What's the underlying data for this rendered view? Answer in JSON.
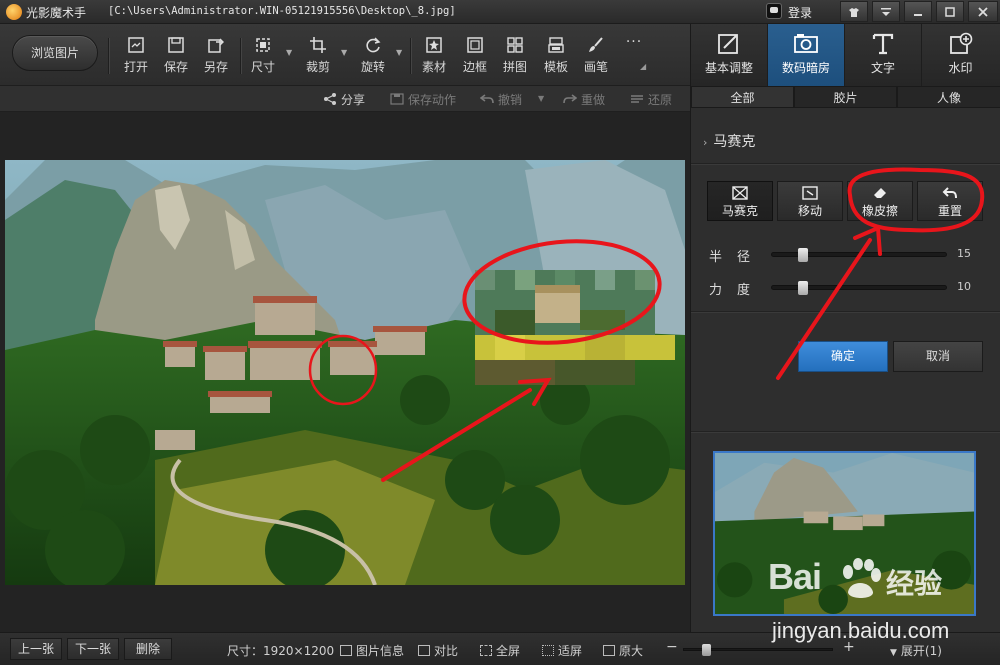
{
  "titlebar": {
    "app_name": "光影魔术手",
    "path": "[C:\\Users\\Administrator.WIN-05121915556\\Desktop\\_8.jpg]",
    "login": "登录"
  },
  "toolbar": {
    "browse": "浏览图片",
    "tools": [
      {
        "label": "打开",
        "icon": "open-icon"
      },
      {
        "label": "保存",
        "icon": "save-icon"
      },
      {
        "label": "另存",
        "icon": "save-as-icon"
      },
      {
        "label": "尺寸",
        "icon": "resize-icon"
      },
      {
        "label": "裁剪",
        "icon": "crop-icon"
      },
      {
        "label": "旋转",
        "icon": "rotate-icon"
      },
      {
        "label": "素材",
        "icon": "material-icon"
      },
      {
        "label": "边框",
        "icon": "border-icon"
      },
      {
        "label": "拼图",
        "icon": "collage-icon"
      },
      {
        "label": "模板",
        "icon": "template-icon"
      },
      {
        "label": "画笔",
        "icon": "brush-icon"
      },
      {
        "label": "···",
        "icon": "more-icon"
      }
    ]
  },
  "modes": [
    {
      "label": "基本调整",
      "icon": "adjust-icon"
    },
    {
      "label": "数码暗房",
      "icon": "darkroom-icon"
    },
    {
      "label": "文字",
      "icon": "text-icon"
    },
    {
      "label": "水印",
      "icon": "watermark-icon"
    }
  ],
  "actions": {
    "share": "分享",
    "save_action": "保存动作",
    "undo": "撤销",
    "redo": "重做",
    "restore": "还原"
  },
  "panel": {
    "tabs": [
      "全部",
      "胶片",
      "人像"
    ],
    "section": "马赛克",
    "subtools": [
      "马赛克",
      "移动",
      "橡皮擦",
      "重置"
    ],
    "sliders": [
      {
        "label_a": "半",
        "label_b": "径",
        "value": "15",
        "level": 0.15
      },
      {
        "label_a": "力",
        "label_b": "度",
        "value": "10",
        "level": 0.15
      }
    ],
    "confirm": "确定",
    "cancel": "取消"
  },
  "statusbar": {
    "prev": "上一张",
    "next": "下一张",
    "delete": "删除",
    "size": "尺寸：1920×1200",
    "info": "图片信息",
    "compare": "对比",
    "fullscreen": "全屏",
    "fit": "适屏",
    "original": "原大",
    "zoom_minus": "−",
    "zoom_plus": "+",
    "zoom_level": 0.12,
    "expand": "展开(1)"
  },
  "watermark": {
    "brand": "Bai",
    "brand2": "经验",
    "url": "jingyan.baidu.com"
  },
  "colors": {
    "accent": "#2a6fb8",
    "annotation_red": "#e8151b"
  }
}
